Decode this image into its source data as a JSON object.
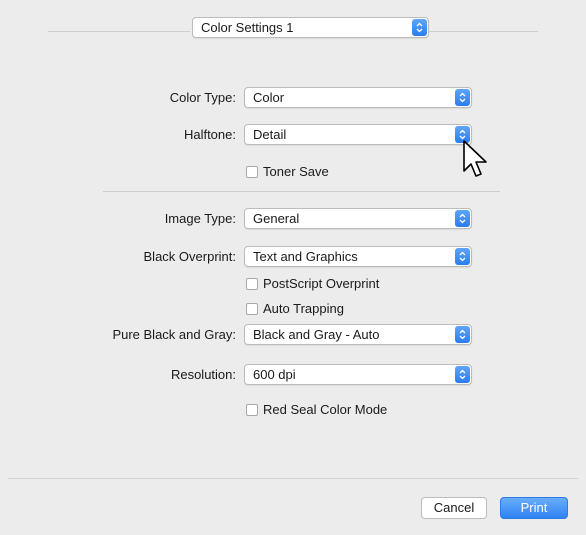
{
  "preset": {
    "selected": "Color Settings 1"
  },
  "fields": {
    "color_type": {
      "label": "Color Type:",
      "value": "Color"
    },
    "halftone": {
      "label": "Halftone:",
      "value": "Detail"
    },
    "toner_save": {
      "label": "Toner Save",
      "checked": false
    },
    "image_type": {
      "label": "Image Type:",
      "value": "General"
    },
    "black_overprint": {
      "label": "Black Overprint:",
      "value": "Text and Graphics"
    },
    "postscript_overprint": {
      "label": "PostScript Overprint",
      "checked": false
    },
    "auto_trapping": {
      "label": "Auto Trapping",
      "checked": false
    },
    "pure_black_gray": {
      "label": "Pure Black and Gray:",
      "value": "Black and Gray - Auto"
    },
    "resolution": {
      "label": "Resolution:",
      "value": "600 dpi"
    },
    "red_seal": {
      "label": "Red Seal Color Mode",
      "checked": false
    }
  },
  "buttons": {
    "cancel": "Cancel",
    "print": "Print"
  },
  "icons": {
    "cursor": "arrow-pointer-icon",
    "stepper": "up-down-chevron-icon"
  },
  "colors": {
    "accent": "#2f82f2",
    "background": "#ececec"
  }
}
